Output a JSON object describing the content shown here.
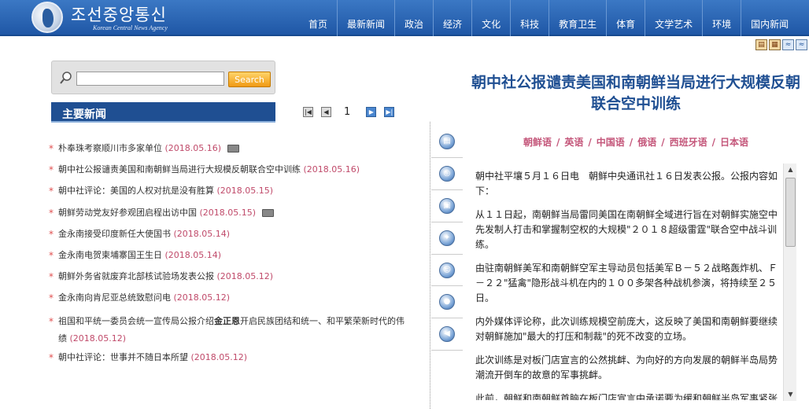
{
  "header": {
    "brand_name": "조선중앙통신",
    "brand_sub": "Korean Central News Agency",
    "nav": [
      "首页",
      "最新新闻",
      "政治",
      "经济",
      "文化",
      "科技",
      "教育卫生",
      "体育",
      "文学艺术",
      "环境",
      "国内新闻"
    ]
  },
  "search": {
    "value": "",
    "placeholder": "",
    "button": "Search"
  },
  "main_news": {
    "title": "主要新闻",
    "page": "1",
    "items": [
      {
        "title": "朴奉珠考察顺川市多家单位",
        "date": "(2018.05.16)",
        "photo": true
      },
      {
        "title": "朝中社公报谴责美国和南朝鲜当局进行大规模反朝联合空中训练",
        "date": "(2018.05.16)",
        "photo": false
      },
      {
        "title": "朝中社评论：美国的人权对抗是没有胜算",
        "date": "(2018.05.15)",
        "photo": false
      },
      {
        "title": "朝鲜劳动党友好参观团启程出访中国",
        "date": "(2018.05.15)",
        "photo": true
      },
      {
        "title": "金永南接受印度新任大使国书",
        "date": "(2018.05.14)",
        "photo": false
      },
      {
        "title": "金永南电贺柬埔寨国王生日",
        "date": "(2018.05.14)",
        "photo": false
      },
      {
        "title": "朝鲜外务省就废弃北部核试验场发表公报",
        "date": "(2018.05.12)",
        "photo": false
      },
      {
        "title": "金永南向肯尼亚总统致慰问电",
        "date": "(2018.05.12)",
        "photo": false
      },
      {
        "title_pre": "祖国和平统一委员会统一宣传局公报介绍",
        "title_bold": "金正恩",
        "title_post": "开启民族团结和统一、和平繁荣新时代的伟绩",
        "date": "(2018.05.12)"
      },
      {
        "title": "朝中社评论：世事并不随日本所望",
        "date": "(2018.05.12)",
        "photo": false
      }
    ]
  },
  "article": {
    "title": "朝中社公报谴责美国和南朝鲜当局进行大规模反朝联合空中训练",
    "languages": [
      "朝鲜语",
      "英语",
      "中国语",
      "俄语",
      "西班牙语",
      "日本语"
    ],
    "paragraphs": [
      "朝中社平壤５月１６日电　朝鲜中央通讯社１６日发表公报。公报内容如下：",
      "从１１日起，南朝鲜当局雷同美国在南朝鲜全域进行旨在对朝鲜实施空中先发制人打击和掌握制空权的大规模\"２０１８超级雷霆\"联合空中战斗训练。",
      "由驻南朝鲜美军和南朝鲜空军主导动员包括美军Ｂ－５２战略轰炸机、Ｆ－２２\"猛禽\"隐形战斗机在内的１００多架各种战机参演，将持续至２５日。",
      "内外媒体评论称，此次训练规模空前庞大，这反映了美国和南朝鲜要继续对朝鲜施加\"最大的打压和制裁\"的死不改变的立场。",
      "此次训练是对板门店宣言的公然挑衅、为向好的方向发展的朝鲜半岛局势潮流开倒车的故意的军事挑衅。",
      "此前，朝鲜和南朝鲜首脑在板门店宣言中承诺要为缓和朝鲜半岛军事紧张局势、消除战争危险进行共同努力。"
    ]
  },
  "icons": {
    "side": [
      "document-icon",
      "film-icon",
      "camera-icon",
      "compass-icon",
      "person-icon",
      "user-icon",
      "back-icon"
    ]
  }
}
